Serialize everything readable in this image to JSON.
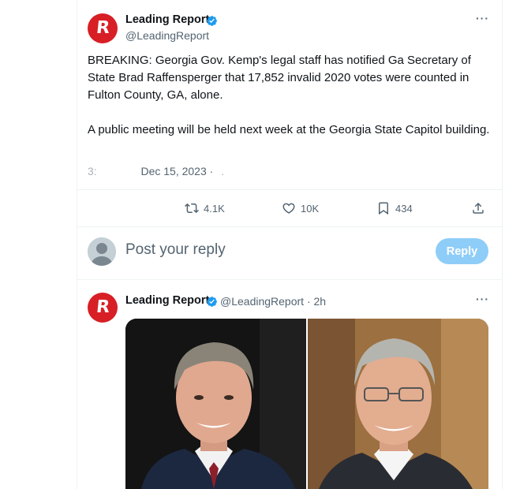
{
  "tweet": {
    "author_name": "Leading Report",
    "author_handle": "@LeadingReport",
    "logo_letter": "R",
    "more_label": "···",
    "body": "BREAKING: Georgia Gov. Kemp's legal staff has notified Ga Secretary of State Brad Raffensperger that 17,852 invalid 2020 votes were counted in Fulton County, GA, alone.\n\nA public meeting will be held next week at the Georgia State Capitol building.",
    "time_obscured": "3:",
    "date": "Dec 15, 2023 ·",
    "views_obscured": ".",
    "actions": {
      "retweets": "4.1K",
      "likes": "10K",
      "bookmarks": "434"
    }
  },
  "reply_composer": {
    "placeholder": "Post your reply",
    "button_label": "Reply"
  },
  "quoted_tweet": {
    "author_name": "Leading Report",
    "author_handle": "@LeadingReport",
    "time": "· 2h",
    "logo_letter": "R",
    "more_label": "···"
  },
  "colors": {
    "brand_red": "#d81f26",
    "verified_blue": "#1d9bf0",
    "reply_button": "#8ecdf8",
    "muted_text": "#536471"
  }
}
